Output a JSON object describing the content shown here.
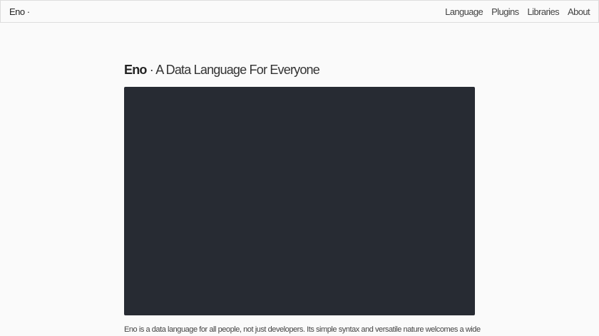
{
  "nav": {
    "brand": "Eno ·",
    "links": [
      "Language",
      "Plugins",
      "Libraries",
      "About"
    ]
  },
  "main": {
    "title_bold": "Eno",
    "title_rest": " · A Data Language For Everyone",
    "intro": "Eno is a data language for all people, not just developers. Its simple syntax and versatile nature welcomes a wide"
  }
}
